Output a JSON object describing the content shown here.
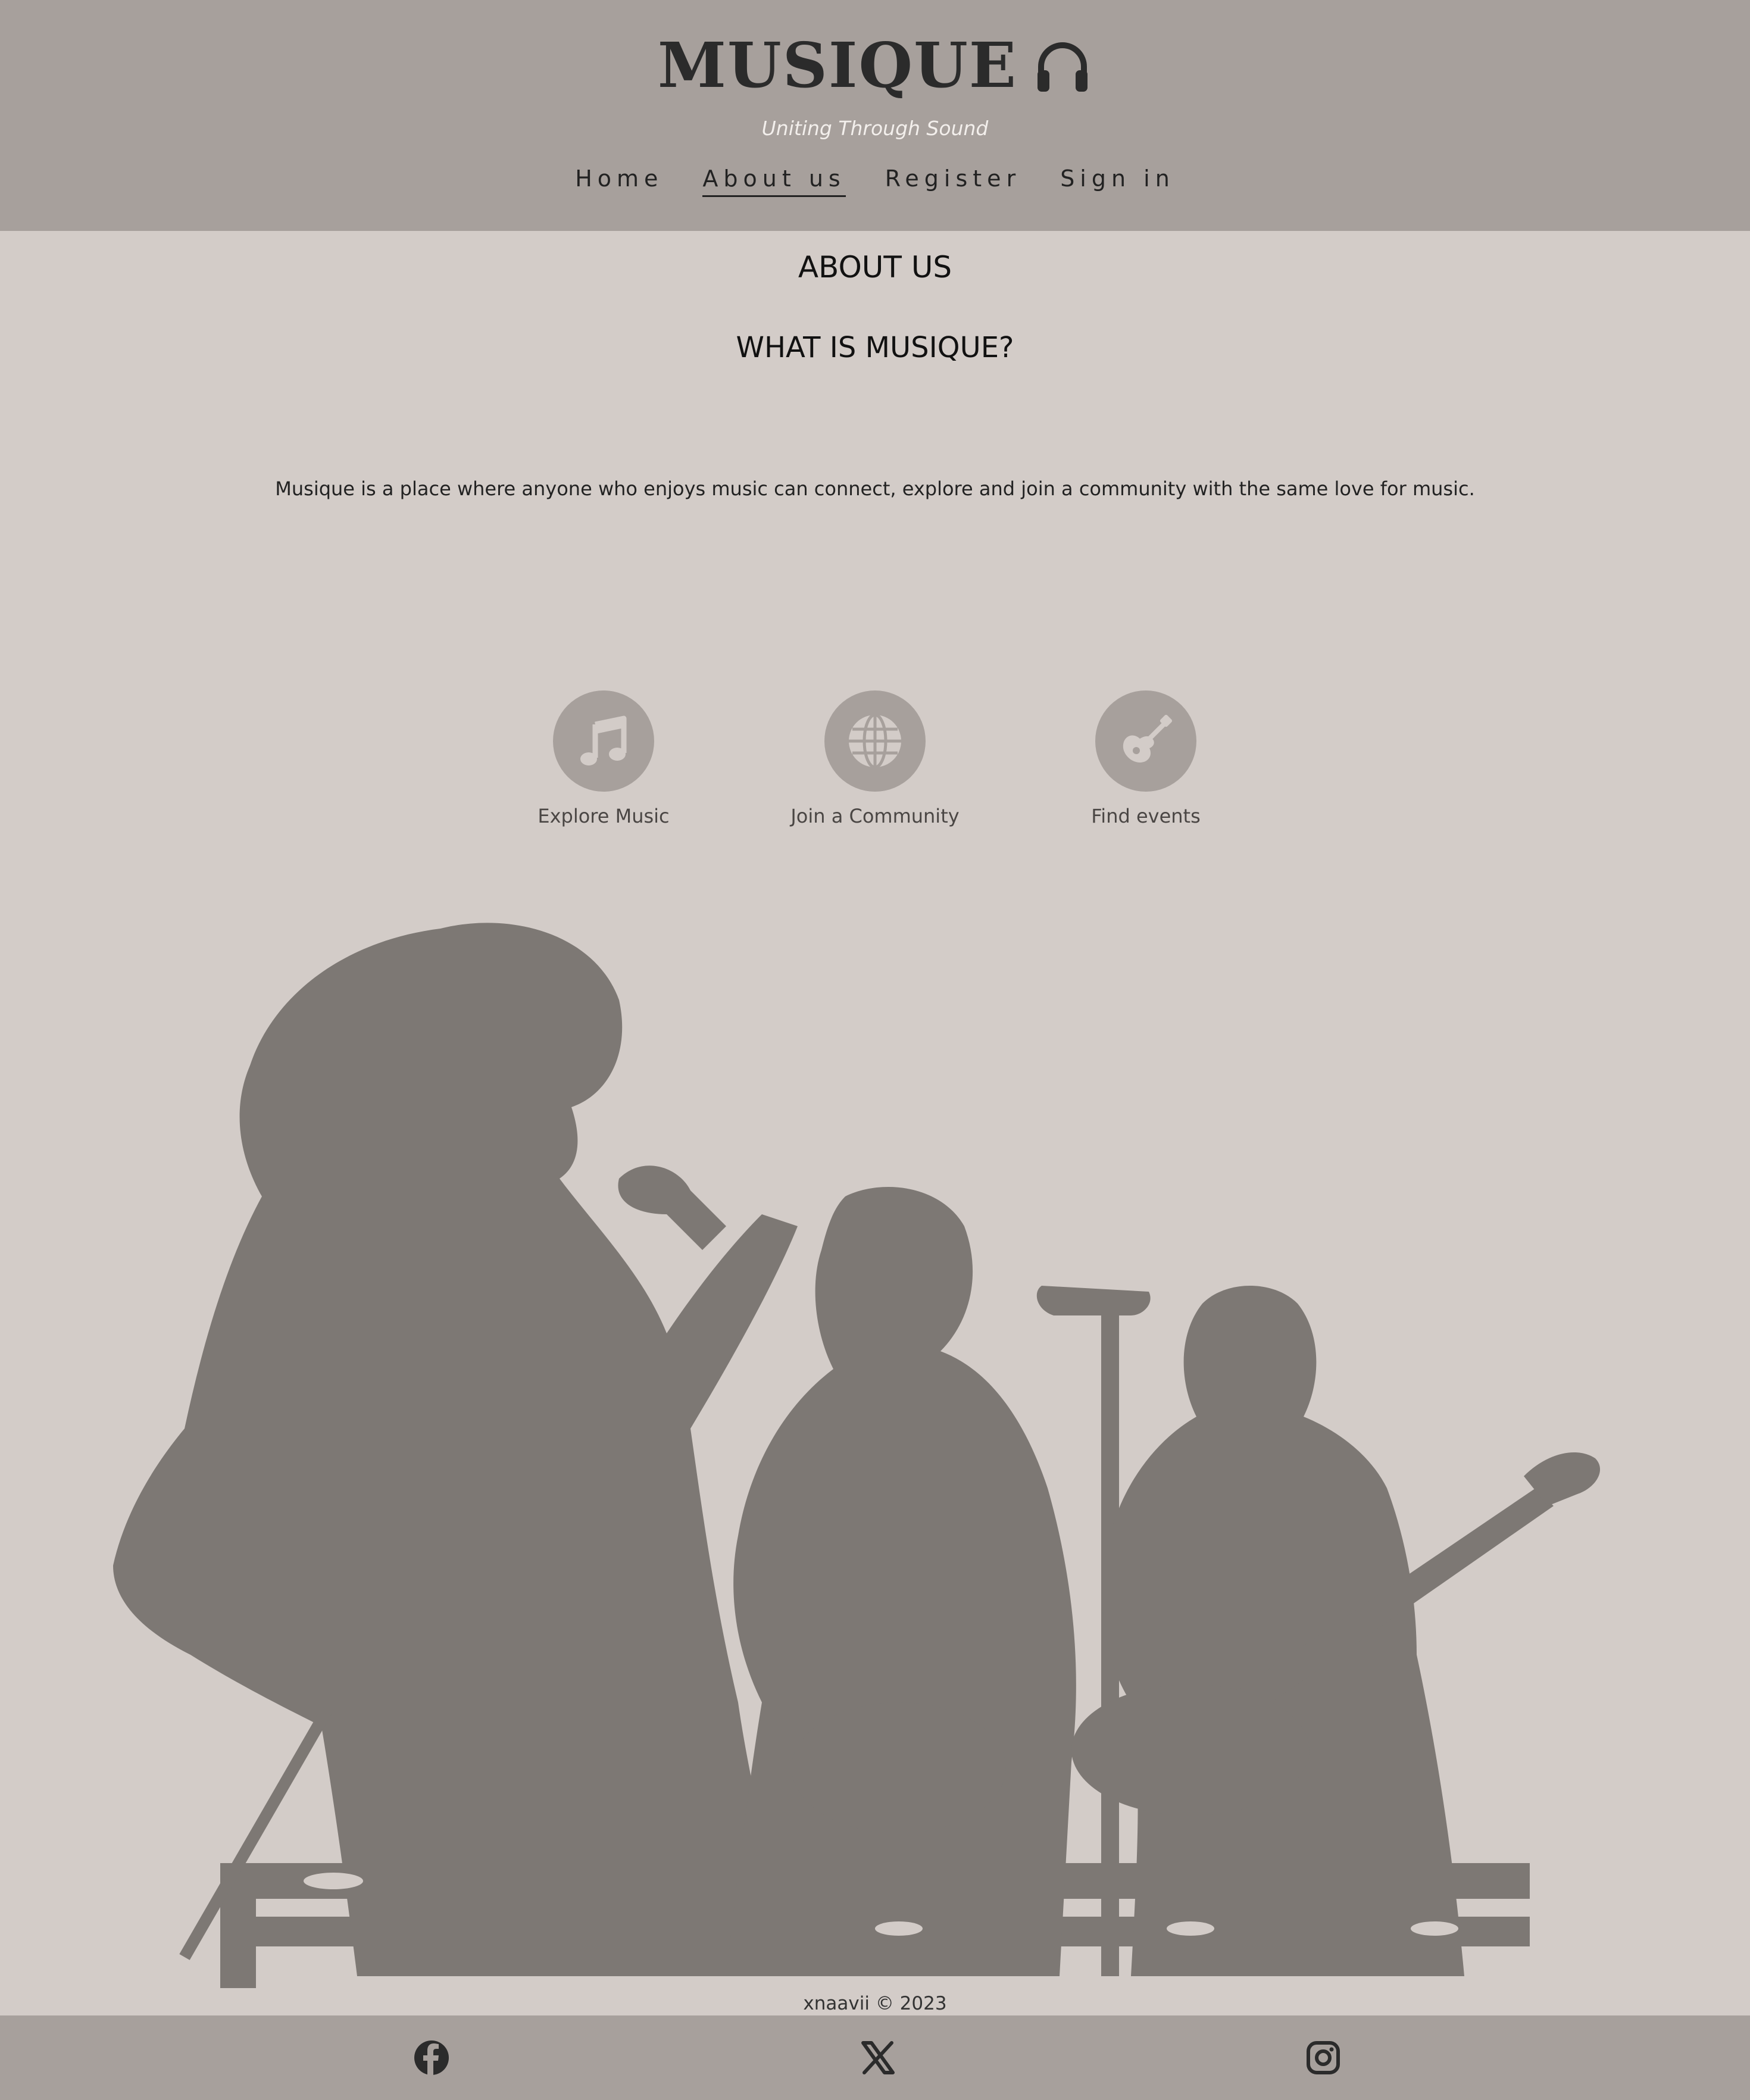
{
  "header": {
    "brand": "MUSIQUE",
    "brand_icon": "headphones-icon",
    "tagline": "Uniting Through Sound",
    "nav": [
      {
        "label": "Home",
        "active": false
      },
      {
        "label": "About us",
        "active": true
      },
      {
        "label": "Register",
        "active": false
      },
      {
        "label": "Sign in",
        "active": false
      }
    ]
  },
  "main": {
    "heading": "ABOUT US",
    "subheading": "WHAT IS MUSIQUE?",
    "intro": "Musique is a place where anyone who enjoys music can connect, explore and join a community with the same love for music.",
    "features": [
      {
        "label": "Explore Music",
        "icon": "music-note-icon"
      },
      {
        "label": "Join a Community",
        "icon": "globe-icon"
      },
      {
        "label": "Find events",
        "icon": "guitar-icon"
      }
    ],
    "illustration": "band-illustration"
  },
  "footer": {
    "copyright": "xnaavii © 2023",
    "social": [
      {
        "icon": "facebook-icon"
      },
      {
        "icon": "x-icon"
      },
      {
        "icon": "instagram-icon"
      }
    ]
  },
  "colors": {
    "header_bg": "#a7a09c",
    "page_bg": "#d3ccc8",
    "illustration": "#7d7874",
    "text_dark": "#222222"
  }
}
